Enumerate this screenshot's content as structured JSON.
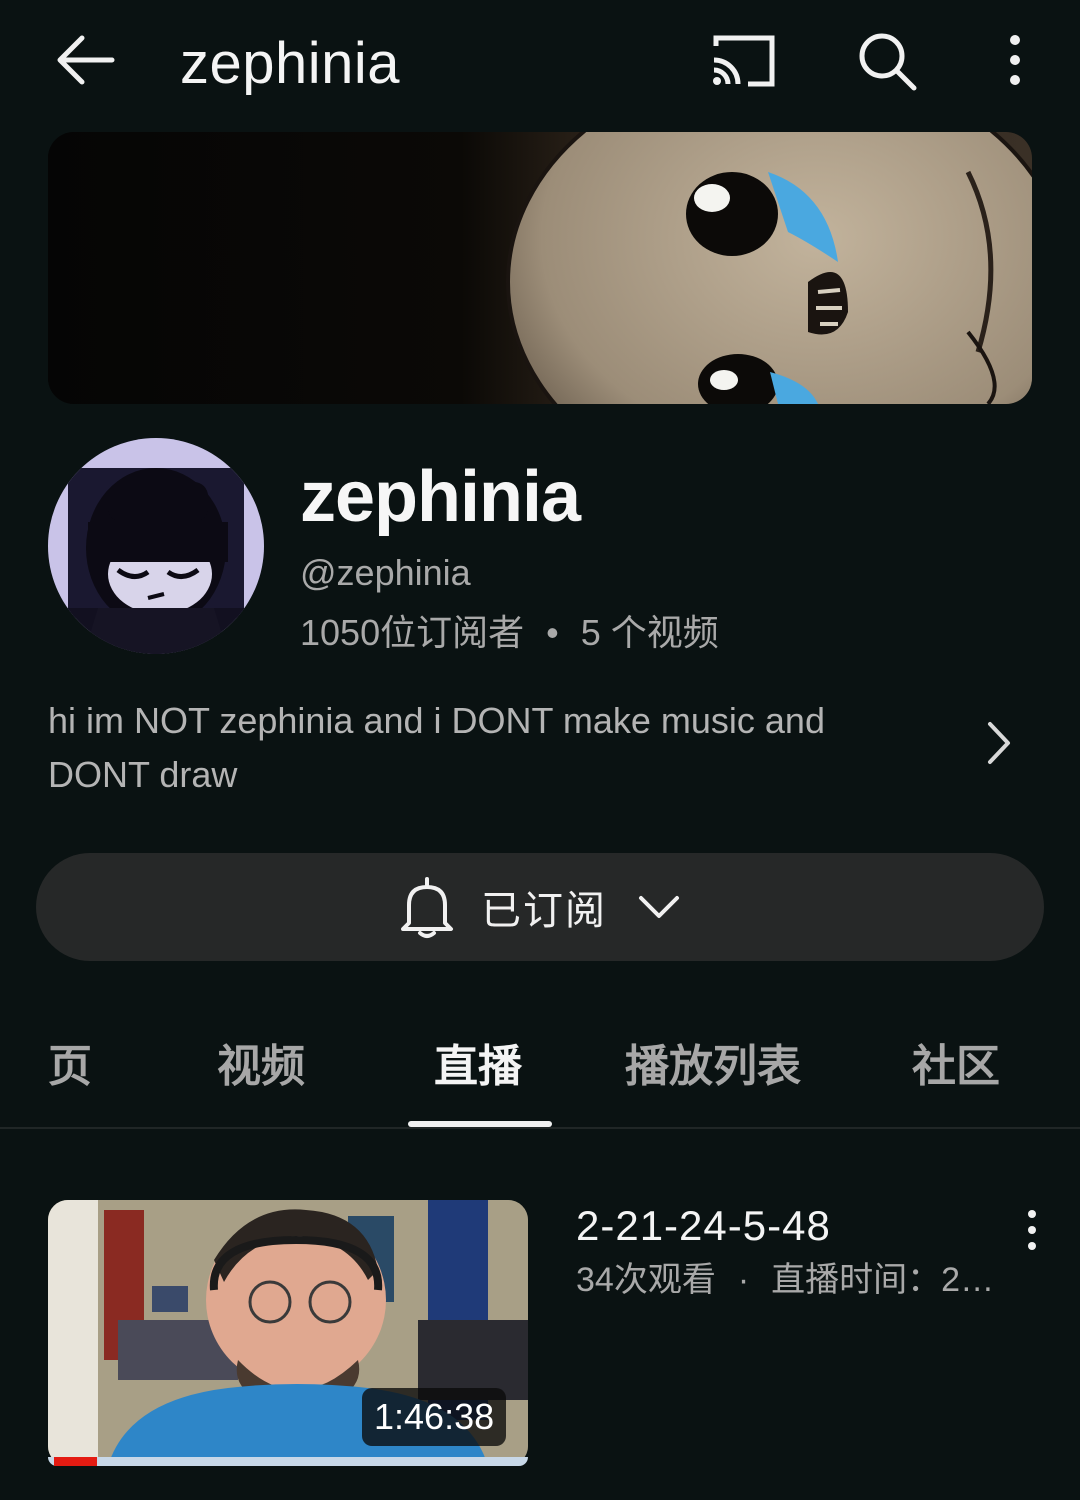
{
  "topbar": {
    "title": "zephinia"
  },
  "channel": {
    "name": "zephinia",
    "handle": "@zephinia",
    "subscribers": "1050位订阅者",
    "separator": "•",
    "video_count": "5 个视频",
    "description": "hi im NOT zephinia and i DONT make music and DONT draw"
  },
  "subscribe": {
    "label": "已订阅"
  },
  "tabs": [
    {
      "label": "页",
      "active": false
    },
    {
      "label": "视频",
      "active": false
    },
    {
      "label": "直播",
      "active": true
    },
    {
      "label": "播放列表",
      "active": false
    },
    {
      "label": "社区",
      "active": false
    }
  ],
  "video": {
    "title": "2-21-24-5-48",
    "views": "34次观看",
    "separator": "·",
    "stream_time": "直播时间：2…",
    "duration": "1:46:38",
    "watched_fraction": 0.09
  },
  "colors": {
    "background": "#0a1212",
    "progress": "#e41b12",
    "pill": "#262828"
  },
  "icons": [
    "back-arrow-icon",
    "cast-icon",
    "search-icon",
    "more-vert-icon",
    "bell-icon",
    "chevron-down-icon",
    "chevron-right-icon"
  ]
}
